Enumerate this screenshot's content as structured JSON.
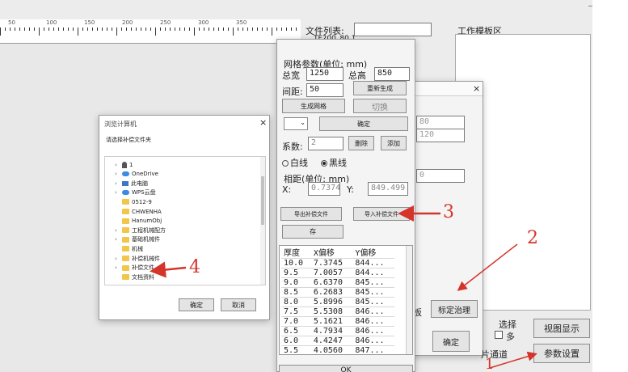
{
  "main": {
    "file_list_label": "文件列表:",
    "file_list_first": "TF200_80.1",
    "work_template_label": "工作模板区",
    "bottom_pick_label": "选择",
    "bottom_pick_option": "多",
    "channel_label": "片通道",
    "view_display_button": "视图显示",
    "param_settings_button": "参数设置",
    "calib_tab_fragment": "板",
    "calib_button": "标定治理",
    "confirm_button": "确定",
    "mid_value_1": "80",
    "mid_value_2": "120",
    "mid_value_3": "0"
  },
  "grid_panel": {
    "title": "网格参数(单位: mm)",
    "total_width_label": "总宽",
    "total_width_value": "1250",
    "total_height_label": "总高",
    "total_height_value": "850",
    "spacing_label": "间距:",
    "spacing_value": "50",
    "regen_button": "重新生成",
    "generate_button": "生成网格",
    "switch_button": "切换",
    "confirm_button": "确定",
    "coef_label": "系数:",
    "coef_value": "2",
    "delete_button": "删除",
    "add_button": "添加",
    "radio_white": "白线",
    "radio_black": "黑线",
    "offset_title": "相距(单位: mm)",
    "x_label": "X:",
    "x_value": "0.7374",
    "y_label": "Y:",
    "y_value": "849.499",
    "export_button": "导出补偿文件",
    "import_button": "导入补偿文件",
    "save_button": "存",
    "table_headers": [
      "厚度",
      "X偏移",
      "Y偏移"
    ],
    "table_rows": [
      [
        "10.0",
        "7.3745",
        "844..."
      ],
      [
        "9.5",
        "7.0057",
        "844..."
      ],
      [
        "9.0",
        "6.6370",
        "845..."
      ],
      [
        "8.5",
        "6.2683",
        "845..."
      ],
      [
        "8.0",
        "5.8996",
        "845..."
      ],
      [
        "7.5",
        "5.5308",
        "846..."
      ],
      [
        "7.0",
        "5.1621",
        "846..."
      ],
      [
        "6.5",
        "4.7934",
        "846..."
      ],
      [
        "6.0",
        "4.4247",
        "846..."
      ],
      [
        "5.5",
        "4.0560",
        "847..."
      ]
    ],
    "bottom_button": "OK"
  },
  "browse": {
    "title": "浏览计算机",
    "subtitle": "请选择补偿文件夹",
    "tree": [
      {
        "label": "1",
        "icon": "person-icon",
        "chev": true
      },
      {
        "label": "OneDrive",
        "icon": "cloud-icon",
        "chev": true
      },
      {
        "label": "此电脑",
        "icon": "computer-icon",
        "chev": true
      },
      {
        "label": "WPS云盘",
        "icon": "cloud-icon",
        "chev": true
      },
      {
        "label": "0512-9",
        "icon": "folder-icon",
        "chev": false
      },
      {
        "label": "CHWENHA",
        "icon": "folder-icon",
        "chev": false
      },
      {
        "label": "HanumObj",
        "icon": "folder-icon",
        "chev": false
      },
      {
        "label": "工程机械配方",
        "icon": "folder-icon",
        "chev": true
      },
      {
        "label": "基础机械件",
        "icon": "folder-icon",
        "chev": true
      },
      {
        "label": "机械",
        "icon": "folder-icon",
        "chev": false
      },
      {
        "label": "补偿机械件",
        "icon": "folder-icon",
        "chev": true
      },
      {
        "label": "补偿文件",
        "icon": "folder-icon",
        "chev": true
      },
      {
        "label": "文档资料",
        "icon": "folder-icon",
        "chev": false
      }
    ],
    "ok_button": "确定",
    "cancel_button": "取消",
    "close_glyph": "×"
  },
  "annotations": [
    "1",
    "2",
    "3",
    "4"
  ],
  "ruler_marks": [
    "50",
    "100",
    "150",
    "200",
    "250",
    "300",
    "350"
  ],
  "colors": {
    "annotation_red": "#d4342a",
    "folder": "#f2c64a"
  }
}
